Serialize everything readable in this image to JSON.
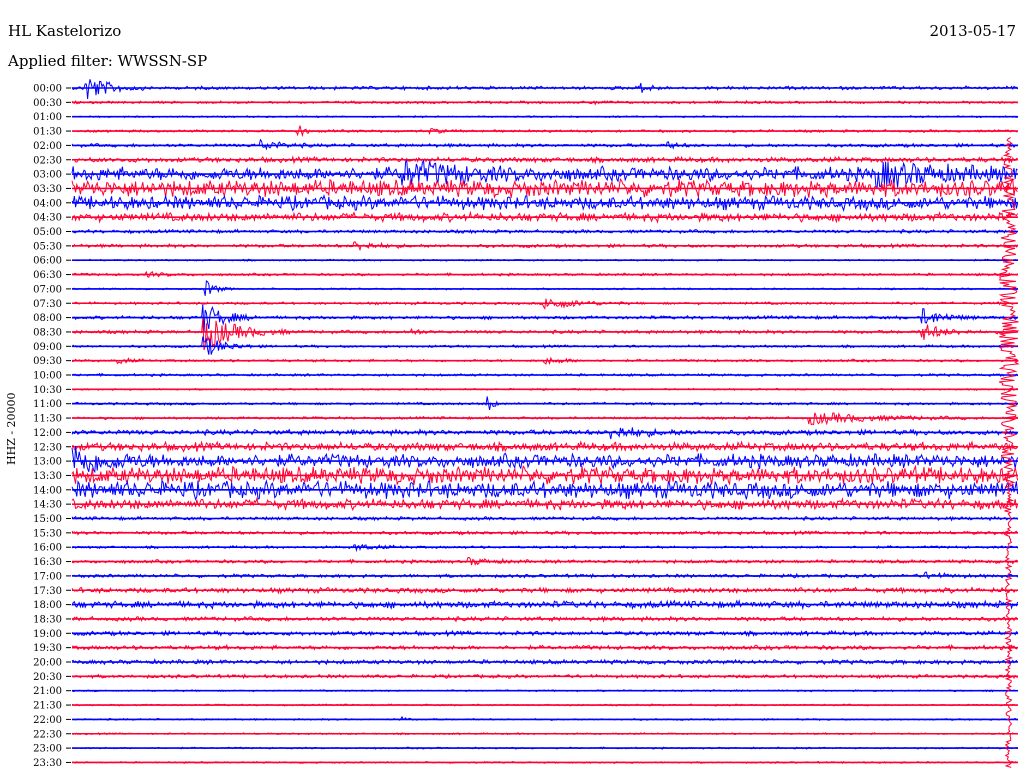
{
  "header": {
    "station": "HL Kastelorizo",
    "date": "2013-05-17",
    "filter": "Applied filter: WWSSN-SP"
  },
  "colors": {
    "blue": "#0000ff",
    "red": "#ff0033",
    "grid": "#000000"
  },
  "chart_data": {
    "type": "line",
    "title": "HL Kastelorizo",
    "ylabel": "HHZ - 20000",
    "xlabel": "",
    "trace_colors": [
      "blue",
      "red"
    ],
    "rows": [
      {
        "label": "00:00",
        "amp": 2,
        "events": [
          {
            "t": 0.015,
            "a": 14,
            "d": 0.02
          },
          {
            "t": 0.6,
            "a": 5,
            "d": 0.01
          }
        ]
      },
      {
        "label": "00:30",
        "amp": 1.5,
        "events": [
          {
            "t": 0.55,
            "a": 2,
            "d": 0.01
          }
        ]
      },
      {
        "label": "01:00",
        "amp": 1,
        "events": []
      },
      {
        "label": "01:30",
        "amp": 1.5,
        "events": [
          {
            "t": 0.24,
            "a": 8,
            "d": 0.005
          },
          {
            "t": 0.38,
            "a": 2,
            "d": 0.01
          }
        ]
      },
      {
        "label": "02:00",
        "amp": 2,
        "events": [
          {
            "t": 0.2,
            "a": 5,
            "d": 0.02
          },
          {
            "t": 0.63,
            "a": 3,
            "d": 0.01
          }
        ]
      },
      {
        "label": "02:30",
        "amp": 3,
        "events": []
      },
      {
        "label": "03:00",
        "amp": 8,
        "events": [
          {
            "t": 0.35,
            "a": 10,
            "d": 0.06
          },
          {
            "t": 0.85,
            "a": 10,
            "d": 0.06
          }
        ]
      },
      {
        "label": "03:30",
        "amp": 10,
        "events": []
      },
      {
        "label": "04:00",
        "amp": 8,
        "events": []
      },
      {
        "label": "04:30",
        "amp": 5,
        "events": []
      },
      {
        "label": "05:00",
        "amp": 2,
        "events": []
      },
      {
        "label": "05:30",
        "amp": 2,
        "events": [
          {
            "t": 0.3,
            "a": 4,
            "d": 0.02
          }
        ]
      },
      {
        "label": "06:00",
        "amp": 1,
        "events": []
      },
      {
        "label": "06:30",
        "amp": 1.5,
        "events": [
          {
            "t": 0.08,
            "a": 2,
            "d": 0.02
          }
        ]
      },
      {
        "label": "07:00",
        "amp": 1,
        "events": [
          {
            "t": 0.14,
            "a": 10,
            "d": 0.01
          }
        ]
      },
      {
        "label": "07:30",
        "amp": 1.5,
        "events": [
          {
            "t": 0.5,
            "a": 6,
            "d": 0.03
          }
        ]
      },
      {
        "label": "08:00",
        "amp": 2,
        "events": [
          {
            "t": 0.14,
            "a": 14,
            "d": 0.02
          },
          {
            "t": 0.9,
            "a": 8,
            "d": 0.02
          }
        ]
      },
      {
        "label": "08:30",
        "amp": 2,
        "events": [
          {
            "t": 0.14,
            "a": 18,
            "d": 0.03
          },
          {
            "t": 0.36,
            "a": 5,
            "d": 0.005
          },
          {
            "t": 0.9,
            "a": 8,
            "d": 0.02
          }
        ]
      },
      {
        "label": "09:00",
        "amp": 1.5,
        "events": [
          {
            "t": 0.14,
            "a": 10,
            "d": 0.02
          }
        ]
      },
      {
        "label": "09:30",
        "amp": 1.5,
        "events": [
          {
            "t": 0.05,
            "a": 3,
            "d": 0.01
          },
          {
            "t": 0.5,
            "a": 3,
            "d": 0.02
          }
        ]
      },
      {
        "label": "10:00",
        "amp": 1.5,
        "events": []
      },
      {
        "label": "10:30",
        "amp": 1,
        "events": []
      },
      {
        "label": "11:00",
        "amp": 1.5,
        "events": [
          {
            "t": 0.44,
            "a": 12,
            "d": 0.004
          }
        ]
      },
      {
        "label": "11:30",
        "amp": 1.5,
        "events": [
          {
            "t": 0.78,
            "a": 6,
            "d": 0.06
          }
        ]
      },
      {
        "label": "12:00",
        "amp": 3,
        "events": [
          {
            "t": 0.57,
            "a": 6,
            "d": 0.03
          }
        ]
      },
      {
        "label": "12:30",
        "amp": 5,
        "events": []
      },
      {
        "label": "13:00",
        "amp": 8,
        "events": [
          {
            "t": 0.0,
            "a": 14,
            "d": 0.03
          }
        ]
      },
      {
        "label": "13:30",
        "amp": 10,
        "events": []
      },
      {
        "label": "14:00",
        "amp": 10,
        "events": []
      },
      {
        "label": "14:30",
        "amp": 6,
        "events": []
      },
      {
        "label": "15:00",
        "amp": 2,
        "events": []
      },
      {
        "label": "15:30",
        "amp": 2,
        "events": []
      },
      {
        "label": "16:00",
        "amp": 1.5,
        "events": [
          {
            "t": 0.3,
            "a": 3,
            "d": 0.02
          }
        ]
      },
      {
        "label": "16:30",
        "amp": 2,
        "events": [
          {
            "t": 0.42,
            "a": 3,
            "d": 0.02
          }
        ]
      },
      {
        "label": "17:00",
        "amp": 2,
        "events": [
          {
            "t": 0.9,
            "a": 3,
            "d": 0.02
          }
        ]
      },
      {
        "label": "17:30",
        "amp": 3,
        "events": []
      },
      {
        "label": "18:00",
        "amp": 4,
        "events": []
      },
      {
        "label": "18:30",
        "amp": 2.5,
        "events": []
      },
      {
        "label": "19:00",
        "amp": 2.5,
        "events": []
      },
      {
        "label": "19:30",
        "amp": 2.5,
        "events": []
      },
      {
        "label": "20:00",
        "amp": 2.5,
        "events": []
      },
      {
        "label": "20:30",
        "amp": 2,
        "events": []
      },
      {
        "label": "21:00",
        "amp": 1,
        "events": []
      },
      {
        "label": "21:30",
        "amp": 1,
        "events": []
      },
      {
        "label": "22:00",
        "amp": 1,
        "events": [
          {
            "t": 0.35,
            "a": 3,
            "d": 0.004
          }
        ]
      },
      {
        "label": "22:30",
        "amp": 1,
        "events": []
      },
      {
        "label": "23:00",
        "amp": 1,
        "events": []
      },
      {
        "label": "23:30",
        "amp": 1,
        "events": []
      }
    ],
    "big_event": {
      "t": 0.99,
      "from_row": 4,
      "to_row": 47,
      "a": 10
    }
  }
}
